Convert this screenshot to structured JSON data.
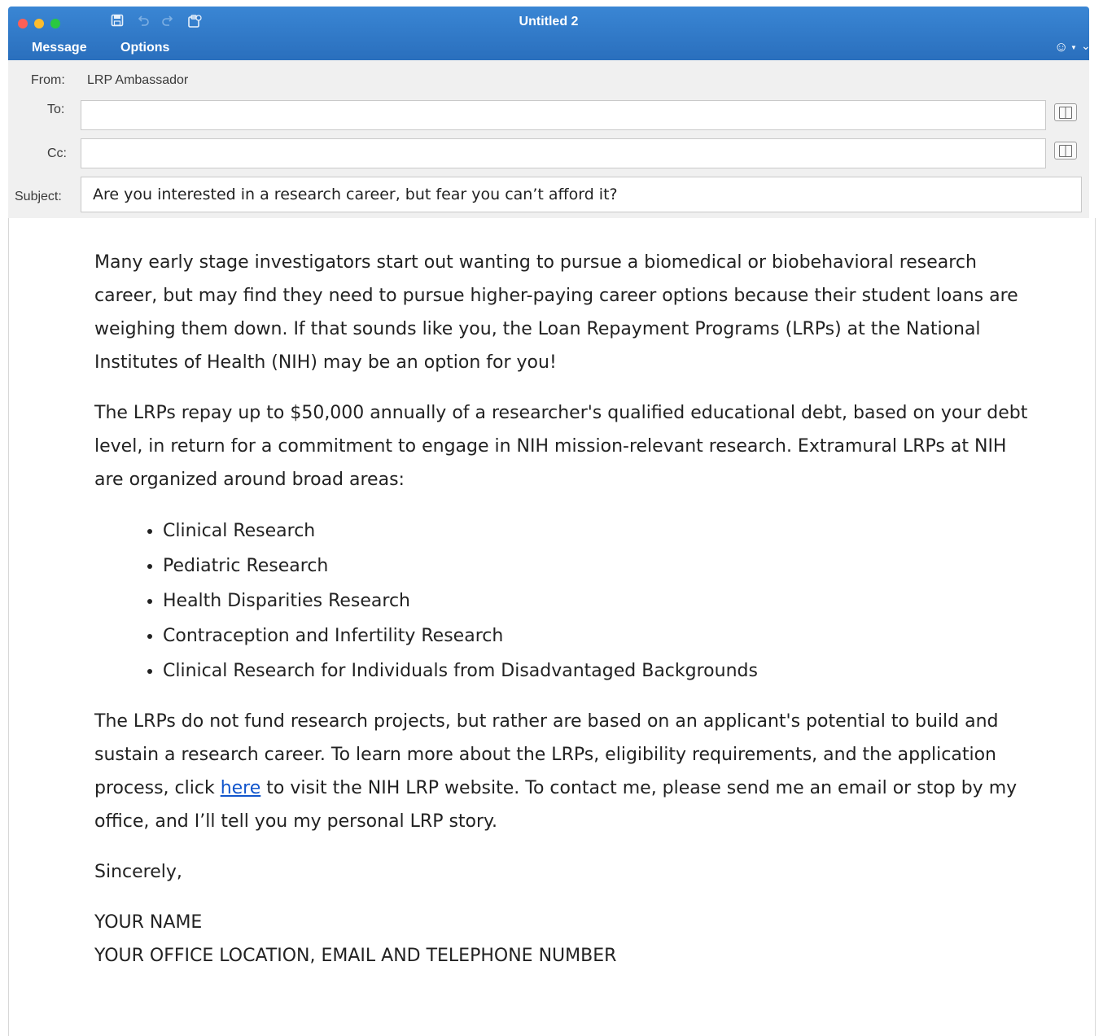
{
  "window": {
    "title": "Untitled 2"
  },
  "toolbar": {
    "save_icon": "floppy-disk-icon",
    "undo_icon": "undo-icon",
    "redo_icon": "redo-icon",
    "clipboard_icon": "clipboard-icon"
  },
  "ribbon": {
    "tabs": [
      {
        "label": "Message"
      },
      {
        "label": "Options"
      }
    ],
    "emoji_icon": "smiley-icon",
    "collapse_icon": "chevron-down-icon"
  },
  "header": {
    "from_label": "From:",
    "from_value": "LRP Ambassador",
    "to_label": "To:",
    "to_value": "",
    "cc_label": "Cc:",
    "cc_value": "",
    "subject_label": "Subject:",
    "subject_value": "Are you interested in a research career, but fear you can’t afford it?"
  },
  "body": {
    "paragraph1": "Many early stage investigators start out wanting to pursue a biomedical or biobehavioral research career, but may find they need to pursue higher-paying career options because their student loans are weighing them down. If that sounds like you, the Loan Repayment Programs (LRPs) at the National Institutes of Health (NIH) may be an option for you!",
    "paragraph2": "The LRPs repay up to $50,000 annually of a researcher's qualified educational debt, based on your debt level, in return for a commitment to engage in NIH mission-relevant research. Extramural LRPs at NIH are organized around broad areas:",
    "areas": [
      "Clinical Research",
      "Pediatric Research",
      "Health Disparities Research",
      "Contraception and Infertility Research",
      "Clinical Research for Individuals from Disadvantaged Backgrounds"
    ],
    "paragraph3_pre": "The LRPs do not fund research projects, but rather are based on an applicant's potential to build and sustain a research career.  To learn more about the LRPs, eligibility requirements, and the application process, click ",
    "paragraph3_link": "here",
    "paragraph3_post": " to visit the NIH LRP website. To contact me, please send me an email or stop by my office, and I’ll tell you my personal LRP story.",
    "closing": "Sincerely,",
    "signature_name": "YOUR NAME",
    "signature_details": "YOUR OFFICE LOCATION, EMAIL AND TELEPHONE NUMBER"
  },
  "colors": {
    "ribbon_blue": "#2f78c8",
    "link_blue": "#1155cc"
  }
}
